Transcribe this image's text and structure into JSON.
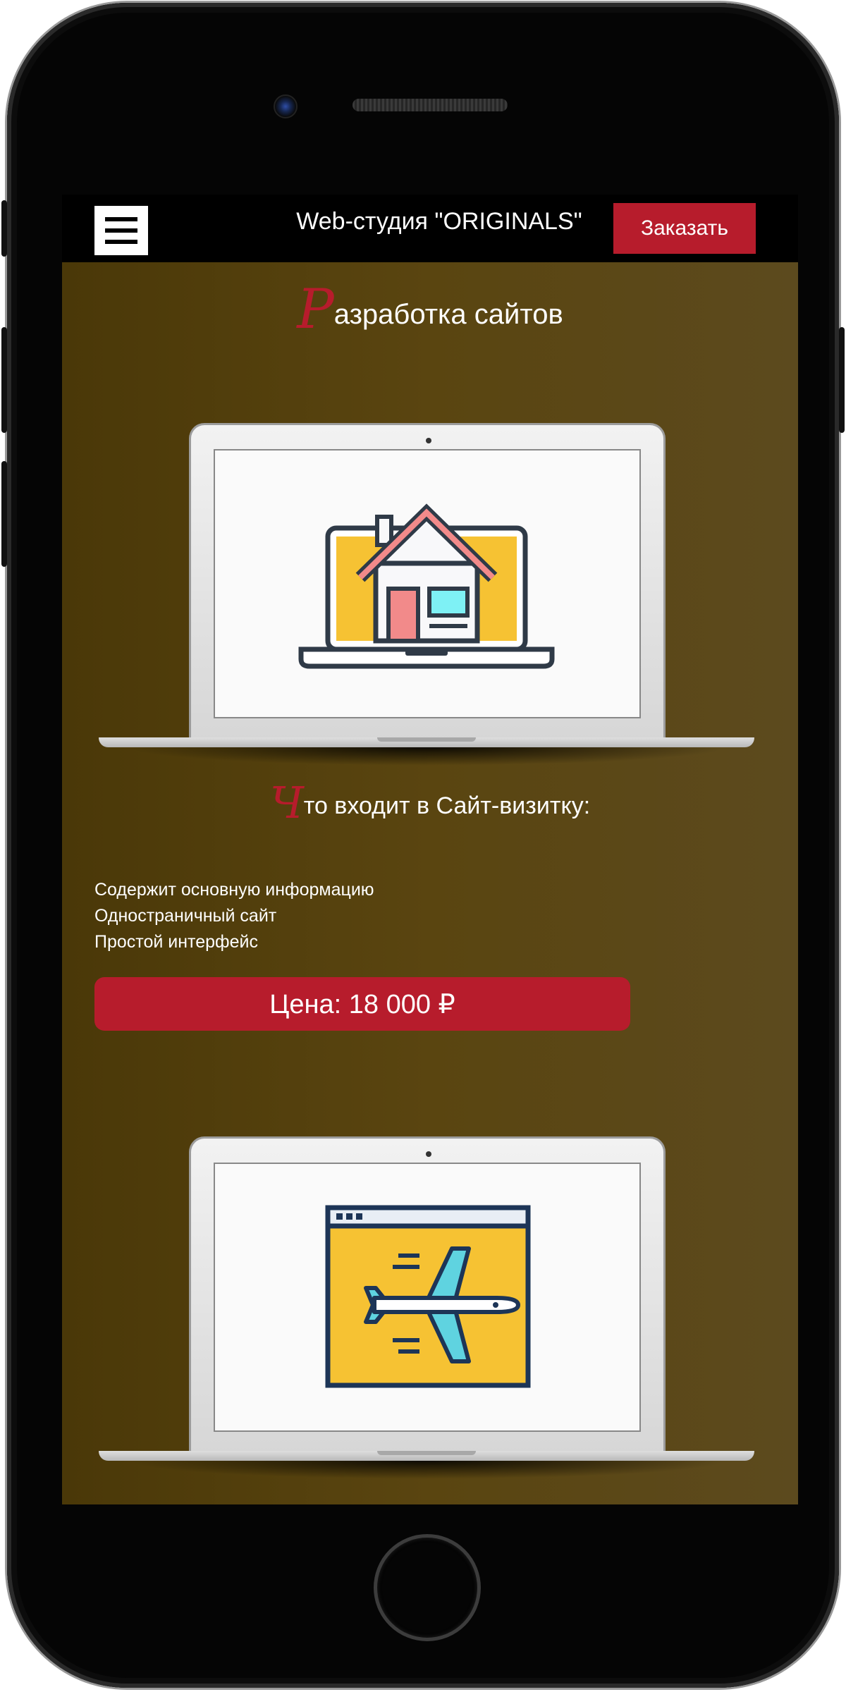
{
  "header": {
    "menu_icon": "hamburger-icon",
    "brand": "Web-студия \"ORIGINALS\"",
    "order_label": "Заказать"
  },
  "page": {
    "title_initial": "Р",
    "title_rest": "азработка сайтов"
  },
  "laptop_1": {
    "icon": "house-on-laptop-icon"
  },
  "section": {
    "title_initial": "Ч",
    "title_rest": "то входит в Сайт-визитку:",
    "features": [
      "Содержит основную информацию",
      "Одностраничный сайт",
      "Простой интерфейс"
    ]
  },
  "price": {
    "label": "Цена: 18 000 ₽"
  },
  "laptop_2": {
    "icon": "airplane-browser-icon"
  },
  "colors": {
    "accent": "#b71c2c",
    "background": "#553f0d",
    "header": "#000000"
  }
}
